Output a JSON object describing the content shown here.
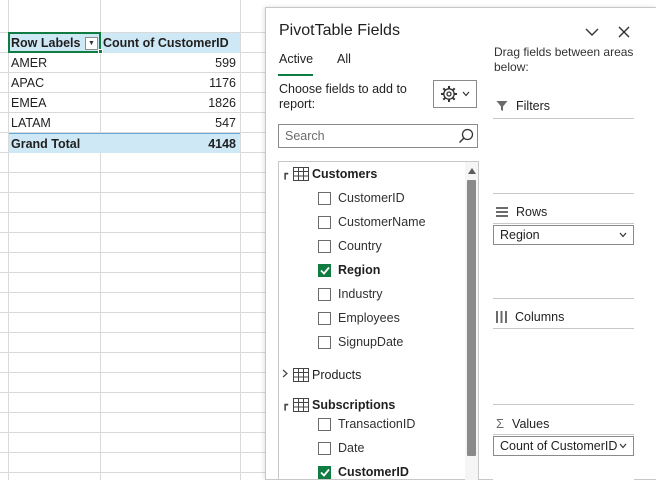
{
  "pivot": {
    "header_row_label": "Row Labels",
    "header_value_label": "Count of CustomerID",
    "rows": [
      {
        "label": "AMER",
        "value": "599"
      },
      {
        "label": "APAC",
        "value": "1176"
      },
      {
        "label": "EMEA",
        "value": "1826"
      },
      {
        "label": "LATAM",
        "value": "547"
      }
    ],
    "total_label": "Grand Total",
    "total_value": "4148"
  },
  "pane": {
    "title": "PivotTable Fields",
    "tabs": [
      {
        "label": "Active",
        "selected": true
      },
      {
        "label": "All",
        "selected": false
      }
    ],
    "choose_text": "Choose fields to add to report:",
    "search_placeholder": "Search",
    "field_groups": [
      {
        "name": "Customers",
        "expanded": true,
        "fields": [
          {
            "name": "CustomerID",
            "checked": false
          },
          {
            "name": "CustomerName",
            "checked": false
          },
          {
            "name": "Country",
            "checked": false
          },
          {
            "name": "Region",
            "checked": true
          },
          {
            "name": "Industry",
            "checked": false
          },
          {
            "name": "Employees",
            "checked": false
          },
          {
            "name": "SignupDate",
            "checked": false
          }
        ]
      },
      {
        "name": "Products",
        "expanded": false,
        "fields": []
      },
      {
        "name": "Subscriptions",
        "expanded": true,
        "fields": [
          {
            "name": "TransactionID",
            "checked": false
          },
          {
            "name": "Date",
            "checked": false
          },
          {
            "name": "CustomerID",
            "checked": true
          }
        ]
      }
    ],
    "drag_text": "Drag fields between areas below:",
    "areas": {
      "filters": {
        "label": "Filters"
      },
      "rows": {
        "label": "Rows",
        "item": "Region"
      },
      "columns": {
        "label": "Columns"
      },
      "values": {
        "label": "Values",
        "item": "Count of CustomerID"
      }
    },
    "colors": {
      "accent": "#107c41",
      "pivot_header_bg": "#cfe8f6"
    }
  }
}
